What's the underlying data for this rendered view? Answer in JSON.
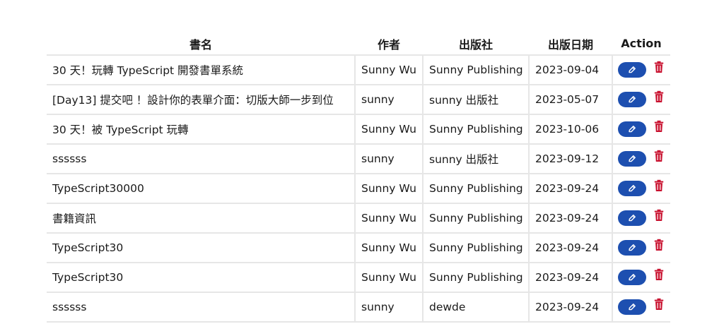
{
  "table": {
    "headers": {
      "name": "書名",
      "author": "作者",
      "publisher": "出版社",
      "date": "出版日期",
      "action": "Action"
    },
    "rows": [
      {
        "name": "30 天！玩轉 TypeScript 開發書單系統",
        "author": "Sunny Wu",
        "publisher": "Sunny Publishing",
        "date": "2023-09-04"
      },
      {
        "name": "[Day13] 提交吧 ！設計你的表單介面：切版大師一步到位",
        "author": "sunny",
        "publisher": "sunny 出版社",
        "date": "2023-05-07"
      },
      {
        "name": "30 天！被 TypeScript 玩轉",
        "author": "Sunny Wu",
        "publisher": "Sunny Publishing",
        "date": "2023-10-06"
      },
      {
        "name": "ssssss",
        "author": "sunny",
        "publisher": "sunny 出版社",
        "date": "2023-09-12"
      },
      {
        "name": "TypeScript30000",
        "author": "Sunny Wu",
        "publisher": "Sunny Publishing",
        "date": "2023-09-24"
      },
      {
        "name": "書籍資訊",
        "author": "Sunny Wu",
        "publisher": "Sunny Publishing",
        "date": "2023-09-24"
      },
      {
        "name": "TypeScript30",
        "author": "Sunny Wu",
        "publisher": "Sunny Publishing",
        "date": "2023-09-24"
      },
      {
        "name": "TypeScript30",
        "author": "Sunny Wu",
        "publisher": "Sunny Publishing",
        "date": "2023-09-24"
      },
      {
        "name": "ssssss",
        "author": "sunny",
        "publisher": "dewde",
        "date": "2023-09-24"
      }
    ],
    "row_actions": {
      "edit_icon": "pencil-icon",
      "delete_icon": "trash-icon"
    }
  },
  "colors": {
    "edit_button": "#1d4fb0",
    "delete_icon": "#c8102e",
    "border": "#e6e6e6",
    "text": "#1a1a1a"
  }
}
